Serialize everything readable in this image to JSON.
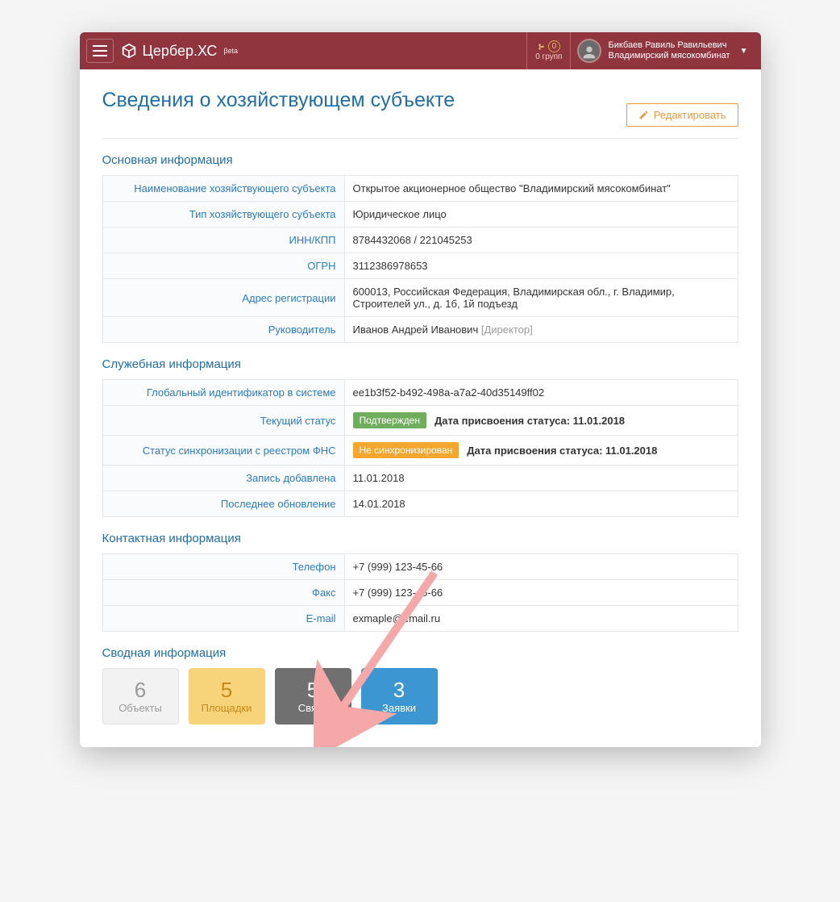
{
  "header": {
    "brand": "Цербер.ХС",
    "beta": "βeta",
    "groups_count": "0",
    "groups_label": "0 групп",
    "user_name": "Бикбаев Равиль Равильевич",
    "user_org": "Владимирский мясокомбинат"
  },
  "page": {
    "title": "Сведения о хозяйствующем субъекте",
    "edit_button": "Редактировать"
  },
  "sections": {
    "main": {
      "title": "Основная информация",
      "rows": {
        "name_label": "Наименование хозяйствующего субъекта",
        "name_value": "Открытое акционерное общество \"Владимирский мясокомбинат\"",
        "type_label": "Тип хозяйствующего субъекта",
        "type_value": "Юридическое лицо",
        "inn_label": "ИНН/КПП",
        "inn_value": "8784432068 / 221045253",
        "ogrn_label": "ОГРН",
        "ogrn_value": "3112386978653",
        "addr_label": "Адрес регистрации",
        "addr_value": "600013, Российская Федерация, Владимирская обл., г. Владимир, Строителей ул., д. 1б, 1й подъезд",
        "head_label": "Руководитель",
        "head_value": "Иванов Андрей Иванович",
        "head_role": "[Директор]"
      }
    },
    "service": {
      "title": "Служебная информация",
      "rows": {
        "guid_label": "Глобальный идентификатор в системе",
        "guid_value": "ee1b3f52-b492-498a-a7a2-40d35149ff02",
        "status_label": "Текущий статус",
        "status_badge": "Подтвержден",
        "status_date_text": "Дата присвоения статуса: 11.01.2018",
        "sync_label": "Статус синхронизации с реестром ФНС",
        "sync_badge": "Не синхронизирован",
        "sync_date_text": "Дата присвоения статуса: 11.01.2018",
        "created_label": "Запись добавлена",
        "created_value": "11.01.2018",
        "updated_label": "Последнее обновление",
        "updated_value": "14.01.2018"
      }
    },
    "contact": {
      "title": "Контактная информация",
      "rows": {
        "phone_label": "Телефон",
        "phone_value": "+7 (999) 123-45-66",
        "fax_label": "Факс",
        "fax_value": "+7 (999) 123-45-66",
        "email_label": "E-mail",
        "email_value": "exmaple@email.ru"
      }
    },
    "summary": {
      "title": "Сводная информация",
      "tiles": {
        "objects_num": "6",
        "objects_label": "Объекты",
        "sites_num": "5",
        "sites_label": "Площадки",
        "links_num": "5",
        "links_label": "Связи",
        "requests_num": "3",
        "requests_label": "Заявки"
      }
    }
  }
}
